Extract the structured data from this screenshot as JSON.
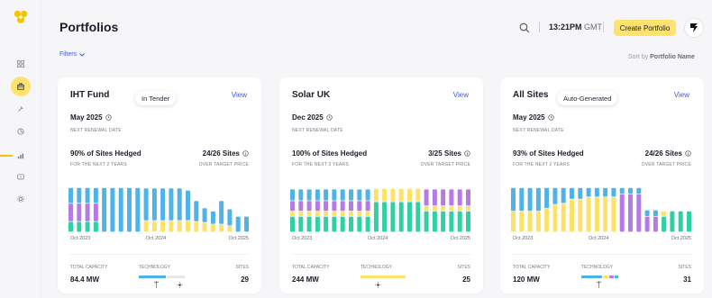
{
  "header": {
    "title": "Portfolios",
    "time": "13:21PM",
    "timezone": "GMT",
    "create_label": "Create Portfolio",
    "filters_label": "Filters",
    "sort_prefix": "Sort by",
    "sort_value": "Portfolio Name"
  },
  "nav_icons": [
    "dashboard-icon",
    "portfolio-icon",
    "tools-icon",
    "analytics-icon",
    "chart-icon",
    "feedback-icon",
    "settings-icon"
  ],
  "colors": {
    "accent": "#ffe36e",
    "link": "#3b5bdb",
    "blue": "#4fb3ea",
    "purple": "#b57ae6",
    "yellow": "#fde26a",
    "green": "#2fd0a3"
  },
  "cards": [
    {
      "name": "IHT Fund",
      "tag": "In Tender",
      "view_label": "View",
      "renewal_date": "May 2025",
      "renewal_label": "NEXT RENEWAL DATE",
      "hedged": "90% of Sites Hedged",
      "hedged_sub": "FOR THE NEXT 2 YEARS",
      "sites_count": "24/26 Sites",
      "sites_sub": "OVER TARGET PRICE",
      "x_labels": [
        "Oct 2023",
        "Oct 2024",
        "Oct 2025"
      ],
      "capacity_label": "TOTAL CAPACITY",
      "capacity": "84.4 MW",
      "technology_label": "TECHNOLOGY",
      "sites_label": "SITES",
      "sites": "29",
      "chart_data": {
        "type": "bar",
        "stacked": true,
        "bars": [
          {
            "blue": 0.3,
            "purple": 0.35,
            "yellow": 0,
            "green": 0.2
          },
          {
            "blue": 0.3,
            "purple": 0.35,
            "yellow": 0,
            "green": 0.2
          },
          {
            "blue": 0.3,
            "purple": 0.35,
            "yellow": 0,
            "green": 0.2
          },
          {
            "blue": 0.3,
            "purple": 0.35,
            "yellow": 0,
            "green": 0.2
          },
          {
            "blue": 0.85,
            "purple": 0,
            "yellow": 0,
            "green": 0
          },
          {
            "blue": 0.85,
            "purple": 0,
            "yellow": 0,
            "green": 0
          },
          {
            "blue": 0.85,
            "purple": 0,
            "yellow": 0,
            "green": 0
          },
          {
            "blue": 0.85,
            "purple": 0,
            "yellow": 0,
            "green": 0
          },
          {
            "blue": 0.85,
            "purple": 0,
            "yellow": 0,
            "green": 0
          },
          {
            "blue": 0.62,
            "purple": 0,
            "yellow": 0.22,
            "green": 0
          },
          {
            "blue": 0.62,
            "purple": 0,
            "yellow": 0.22,
            "green": 0
          },
          {
            "blue": 0.62,
            "purple": 0,
            "yellow": 0.22,
            "green": 0
          },
          {
            "blue": 0.62,
            "purple": 0,
            "yellow": 0.22,
            "green": 0
          },
          {
            "blue": 0.62,
            "purple": 0,
            "yellow": 0.22,
            "green": 0
          },
          {
            "blue": 0.58,
            "purple": 0,
            "yellow": 0.22,
            "green": 0
          },
          {
            "blue": 0.4,
            "purple": 0,
            "yellow": 0.2,
            "green": 0
          },
          {
            "blue": 0.28,
            "purple": 0,
            "yellow": 0.18,
            "green": 0
          },
          {
            "blue": 0.25,
            "purple": 0,
            "yellow": 0.15,
            "green": 0
          },
          {
            "blue": 0.45,
            "purple": 0,
            "yellow": 0.15,
            "green": 0
          },
          {
            "blue": 0.32,
            "purple": 0,
            "yellow": 0.12,
            "green": 0
          },
          {
            "blue": 0.3,
            "purple": 0,
            "yellow": 0,
            "green": 0
          },
          {
            "blue": 0.3,
            "purple": 0,
            "yellow": 0,
            "green": 0
          }
        ],
        "tech_segments": [
          {
            "color": "#4fb3ea",
            "w": 0.6
          },
          {
            "color": "#e8e8ec",
            "w": 0.4
          }
        ],
        "tech_icons": [
          "wind-icon",
          "solar-icon"
        ]
      }
    },
    {
      "name": "Solar UK",
      "tag": "",
      "view_label": "View",
      "renewal_date": "Dec 2025",
      "renewal_label": "NEXT RENEWAL DATE",
      "hedged": "100% of Sites Hedged",
      "hedged_sub": "FOR THE NEXT 2 YEARS",
      "sites_count": "3/25 Sites",
      "sites_sub": "OVER TARGET PRICE",
      "x_labels": [
        "Oct 2023",
        "Oct 2024",
        "Oct 2025"
      ],
      "capacity_label": "TOTAL CAPACITY",
      "capacity": "244 MW",
      "technology_label": "TECHNOLOGY",
      "sites_label": "SITES",
      "sites": "25",
      "chart_data": {
        "type": "bar",
        "stacked": true,
        "bars": [
          {
            "blue": 0.22,
            "purple": 0.2,
            "yellow": 0.1,
            "green": 0.3
          },
          {
            "blue": 0.22,
            "purple": 0.2,
            "yellow": 0.1,
            "green": 0.3
          },
          {
            "blue": 0.22,
            "purple": 0.2,
            "yellow": 0.1,
            "green": 0.3
          },
          {
            "blue": 0.22,
            "purple": 0.2,
            "yellow": 0.1,
            "green": 0.3
          },
          {
            "blue": 0.22,
            "purple": 0.2,
            "yellow": 0.1,
            "green": 0.3
          },
          {
            "blue": 0.22,
            "purple": 0.2,
            "yellow": 0.1,
            "green": 0.3
          },
          {
            "blue": 0.22,
            "purple": 0.2,
            "yellow": 0.1,
            "green": 0.3
          },
          {
            "blue": 0.22,
            "purple": 0.2,
            "yellow": 0.1,
            "green": 0.3
          },
          {
            "blue": 0.22,
            "purple": 0.2,
            "yellow": 0.1,
            "green": 0.3
          },
          {
            "blue": 0.22,
            "purple": 0.2,
            "yellow": 0.1,
            "green": 0.3
          },
          {
            "blue": 0,
            "purple": 0,
            "yellow": 0.25,
            "green": 0.58
          },
          {
            "blue": 0,
            "purple": 0,
            "yellow": 0.25,
            "green": 0.58
          },
          {
            "blue": 0,
            "purple": 0,
            "yellow": 0.25,
            "green": 0.58
          },
          {
            "blue": 0,
            "purple": 0,
            "yellow": 0.25,
            "green": 0.58
          },
          {
            "blue": 0,
            "purple": 0,
            "yellow": 0.25,
            "green": 0.58
          },
          {
            "blue": 0,
            "purple": 0,
            "yellow": 0.25,
            "green": 0.58
          },
          {
            "blue": 0,
            "purple": 0.32,
            "yellow": 0.1,
            "green": 0.4
          },
          {
            "blue": 0,
            "purple": 0.32,
            "yellow": 0.1,
            "green": 0.4
          },
          {
            "blue": 0,
            "purple": 0.32,
            "yellow": 0.1,
            "green": 0.4
          },
          {
            "blue": 0,
            "purple": 0.32,
            "yellow": 0.1,
            "green": 0.4
          },
          {
            "blue": 0,
            "purple": 0.32,
            "yellow": 0.1,
            "green": 0.4
          },
          {
            "blue": 0,
            "purple": 0.32,
            "yellow": 0.1,
            "green": 0.4
          }
        ],
        "tech_segments": [
          {
            "color": "#fde26a",
            "w": 1.0
          }
        ],
        "tech_icons": [
          "solar-icon"
        ]
      }
    },
    {
      "name": "All Sites",
      "tag": "Auto-Generated",
      "view_label": "View",
      "renewal_date": "May 2025",
      "renewal_label": "NEXT RENEWAL DATE",
      "hedged": "93% of Sites Hedged",
      "hedged_sub": "FOR THE NEXT 2 YEARS",
      "sites_count": "24/26 Sites",
      "sites_sub": "OVER TARGET PRICE",
      "x_labels": [
        "Oct 2023",
        "Oct 2024",
        "Oct 2025"
      ],
      "capacity_label": "TOTAL CAPACITY",
      "capacity": "120 MW",
      "technology_label": "TECHNOLOGY",
      "sites_label": "SITES",
      "sites": "31",
      "chart_data": {
        "type": "bar",
        "stacked": true,
        "bars": [
          {
            "blue": 0.45,
            "purple": 0,
            "yellow": 0.4,
            "green": 0
          },
          {
            "blue": 0.45,
            "purple": 0,
            "yellow": 0.4,
            "green": 0
          },
          {
            "blue": 0.45,
            "purple": 0,
            "yellow": 0.4,
            "green": 0
          },
          {
            "blue": 0.45,
            "purple": 0,
            "yellow": 0.4,
            "green": 0
          },
          {
            "blue": 0.4,
            "purple": 0,
            "yellow": 0.45,
            "green": 0
          },
          {
            "blue": 0.32,
            "purple": 0,
            "yellow": 0.53,
            "green": 0
          },
          {
            "blue": 0.3,
            "purple": 0,
            "yellow": 0.55,
            "green": 0
          },
          {
            "blue": 0.22,
            "purple": 0,
            "yellow": 0.63,
            "green": 0
          },
          {
            "blue": 0.22,
            "purple": 0,
            "yellow": 0.63,
            "green": 0
          },
          {
            "blue": 0.18,
            "purple": 0,
            "yellow": 0.67,
            "green": 0
          },
          {
            "blue": 0.18,
            "purple": 0,
            "yellow": 0.67,
            "green": 0
          },
          {
            "blue": 0.18,
            "purple": 0,
            "yellow": 0.67,
            "green": 0
          },
          {
            "blue": 0.18,
            "purple": 0,
            "yellow": 0.67,
            "green": 0
          },
          {
            "blue": 0.12,
            "purple": 0.73,
            "yellow": 0,
            "green": 0
          },
          {
            "blue": 0.12,
            "purple": 0.73,
            "yellow": 0,
            "green": 0
          },
          {
            "blue": 0.12,
            "purple": 0.73,
            "yellow": 0,
            "green": 0
          },
          {
            "blue": 0.12,
            "purple": 0.3,
            "yellow": 0,
            "green": 0
          },
          {
            "blue": 0.12,
            "purple": 0.3,
            "yellow": 0,
            "green": 0
          },
          {
            "blue": 0,
            "purple": 0,
            "yellow": 0.1,
            "green": 0.3
          },
          {
            "blue": 0,
            "purple": 0,
            "yellow": 0,
            "green": 0.4
          },
          {
            "blue": 0,
            "purple": 0,
            "yellow": 0,
            "green": 0.4
          },
          {
            "blue": 0,
            "purple": 0,
            "yellow": 0,
            "green": 0.4
          }
        ],
        "tech_segments": [
          {
            "color": "#4fb3ea",
            "w": 0.45
          },
          {
            "color": "#fde26a",
            "w": 0.12
          },
          {
            "color": "#b57ae6",
            "w": 0.1
          },
          {
            "color": "#2fd0a3",
            "w": 0.08
          }
        ],
        "tech_icons": [
          "wind-icon"
        ]
      }
    }
  ]
}
